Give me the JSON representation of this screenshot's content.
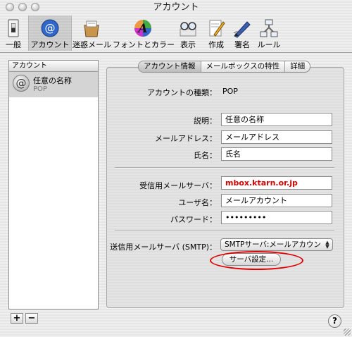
{
  "window": {
    "title": "アカウント"
  },
  "toolbar": {
    "items": [
      {
        "label": "一般",
        "icon": "light-switch-icon"
      },
      {
        "label": "アカウント",
        "icon": "at-sign-icon"
      },
      {
        "label": "迷惑メール",
        "icon": "junk-mail-icon"
      },
      {
        "label": "フォントとカラー",
        "icon": "font-color-icon"
      },
      {
        "label": "表示",
        "icon": "glasses-icon"
      },
      {
        "label": "作成",
        "icon": "compose-pencil-icon"
      },
      {
        "label": "署名",
        "icon": "signature-pen-icon"
      },
      {
        "label": "ルール",
        "icon": "rules-icon"
      }
    ]
  },
  "accounts": {
    "header": "アカウント",
    "items": [
      {
        "name": "任意の名称",
        "type": "POP"
      }
    ]
  },
  "tabs": [
    {
      "label": "アカウント情報",
      "selected": true
    },
    {
      "label": "メールボックスの特性",
      "selected": false
    },
    {
      "label": "詳細",
      "selected": false
    }
  ],
  "form": {
    "account_type_label": "アカウントの種類：",
    "account_type_value": "POP",
    "description_label": "説明：",
    "description_value": "任意の名称",
    "email_label": "メールアドレス：",
    "email_value": "メールアドレス",
    "fullname_label": "氏名：",
    "fullname_value": "氏名",
    "incoming_label": "受信用メールサーバ：",
    "incoming_value": "mbox.ktarn.or.jp",
    "username_label": "ユーザ名：",
    "username_value": "メールアカウント",
    "password_label": "パスワード：",
    "password_value": "•••••••••",
    "smtp_label": "送信用メールサーバ (SMTP)：",
    "smtp_value": "SMTPサーバ:メールアカウン",
    "server_settings_button": "サーバ設定..."
  },
  "bottom": {
    "add": "+",
    "remove": "−",
    "help": "?"
  },
  "colors": {
    "highlight": "#e00000",
    "incoming_text": "#d40000"
  }
}
